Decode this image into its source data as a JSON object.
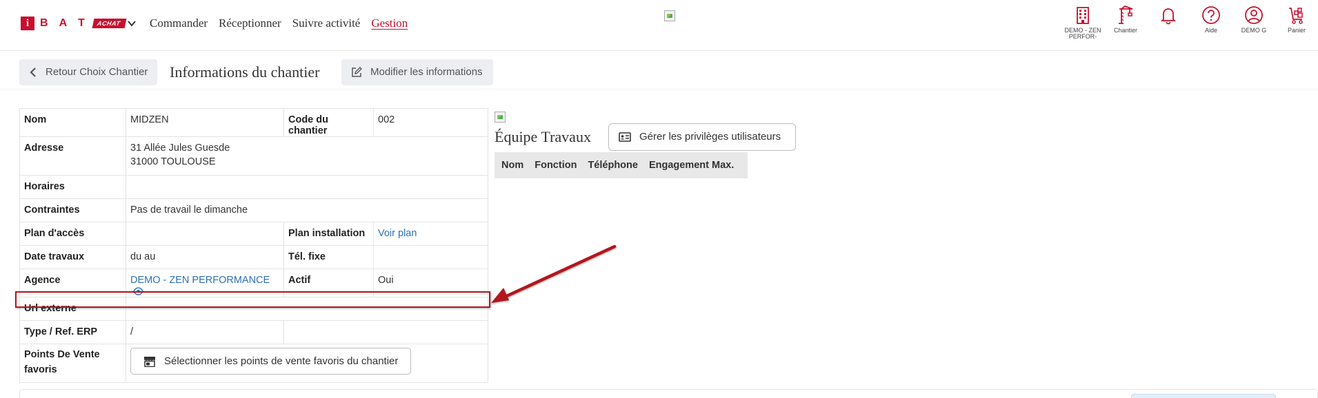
{
  "brand": {
    "logo_i": "i",
    "logo_letters": [
      "B",
      "A",
      "T"
    ],
    "logo_badge": "ACHAT"
  },
  "nav": {
    "items": [
      "Commander",
      "Réceptionner",
      "Suivre activité",
      "Gestion"
    ],
    "active": "Gestion"
  },
  "top_icons": [
    {
      "name": "building-icon",
      "label": "DEMO - ZEN PERFOR-"
    },
    {
      "name": "crane-icon",
      "label": "Chantier"
    },
    {
      "name": "bell-icon",
      "label": ""
    },
    {
      "name": "help-icon",
      "label": "Aide"
    },
    {
      "name": "user-icon",
      "label": "DEMO G"
    },
    {
      "name": "cart-icon",
      "label": "Panier"
    }
  ],
  "toolbar": {
    "back_label": "Retour Choix Chantier",
    "title": "Informations du chantier",
    "edit_label": "Modifier les informations"
  },
  "info": {
    "nom_k": "Nom",
    "nom_v": "MIDZEN",
    "code_k": "Code du chantier",
    "code_v": "002",
    "adresse_k": "Adresse",
    "adresse_l1": "31 Allée Jules Guesde",
    "adresse_l2": "31000 TOULOUSE",
    "horaires_k": "Horaires",
    "horaires_v": "",
    "contraintes_k": "Contraintes",
    "contraintes_v": "Pas de travail le dimanche",
    "plan_acces_k": "Plan d'accès",
    "plan_acces_v": "",
    "plan_install_k": "Plan installation",
    "plan_install_v": "Voir plan",
    "date_k": "Date travaux",
    "date_v": "du au",
    "tel_k": "Tél. fixe",
    "tel_v": "",
    "agence_k": "Agence",
    "agence_v": "DEMO - ZEN PERFORMANCE",
    "actif_k": "Actif",
    "actif_v": "Oui",
    "url_k": "Url externe",
    "url_v": "",
    "erp_k": "Type / Ref. ERP",
    "erp_v": "/",
    "pdv_k": "Points De Vente favoris",
    "pdv_button": "Sélectionner les points de vente favoris du chantier"
  },
  "equipe": {
    "title": "Équipe Travaux",
    "priv_button": "Gérer les privilèges utilisateurs",
    "columns": [
      "Nom",
      "Fonction",
      "Téléphone",
      "Engagement Max."
    ]
  },
  "colors": {
    "brand_red": "#c8102e",
    "link_blue": "#2e6fb5",
    "annotation_red": "#b3151c"
  }
}
